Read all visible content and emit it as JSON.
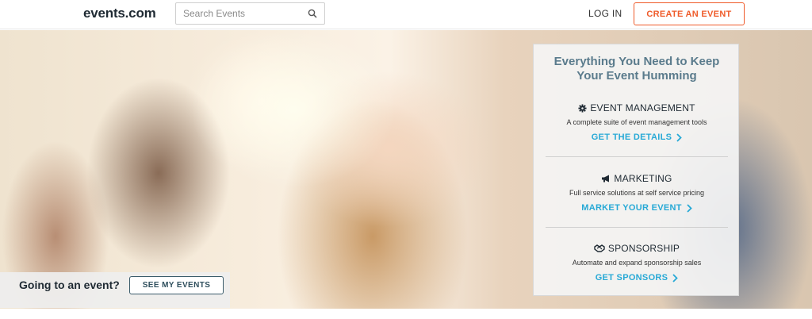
{
  "header": {
    "logo": "events.com",
    "search_placeholder": "Search Events",
    "login_label": "LOG IN",
    "create_label": "CREATE AN EVENT"
  },
  "hero": {
    "going_text": "Going to an event?",
    "see_events_label": "SEE MY EVENTS"
  },
  "panel": {
    "title_line1": "Everything You Need to Keep",
    "title_line2": "Your Event Humming",
    "sections": [
      {
        "icon": "gear-icon",
        "title": "EVENT MANAGEMENT",
        "desc": "A complete suite of event management tools",
        "link": "GET THE DETAILS"
      },
      {
        "icon": "megaphone-icon",
        "title": "MARKETING",
        "desc": "Full service solutions at self service pricing",
        "link": "MARKET YOUR EVENT"
      },
      {
        "icon": "handshake-icon",
        "title": "SPONSORSHIP",
        "desc": "Automate and expand sponsorship sales",
        "link": "GET SPONSORS"
      }
    ]
  },
  "colors": {
    "accent_orange": "#ef5b2a",
    "link_blue": "#27a9d6",
    "panel_title": "#5a7b8c"
  }
}
